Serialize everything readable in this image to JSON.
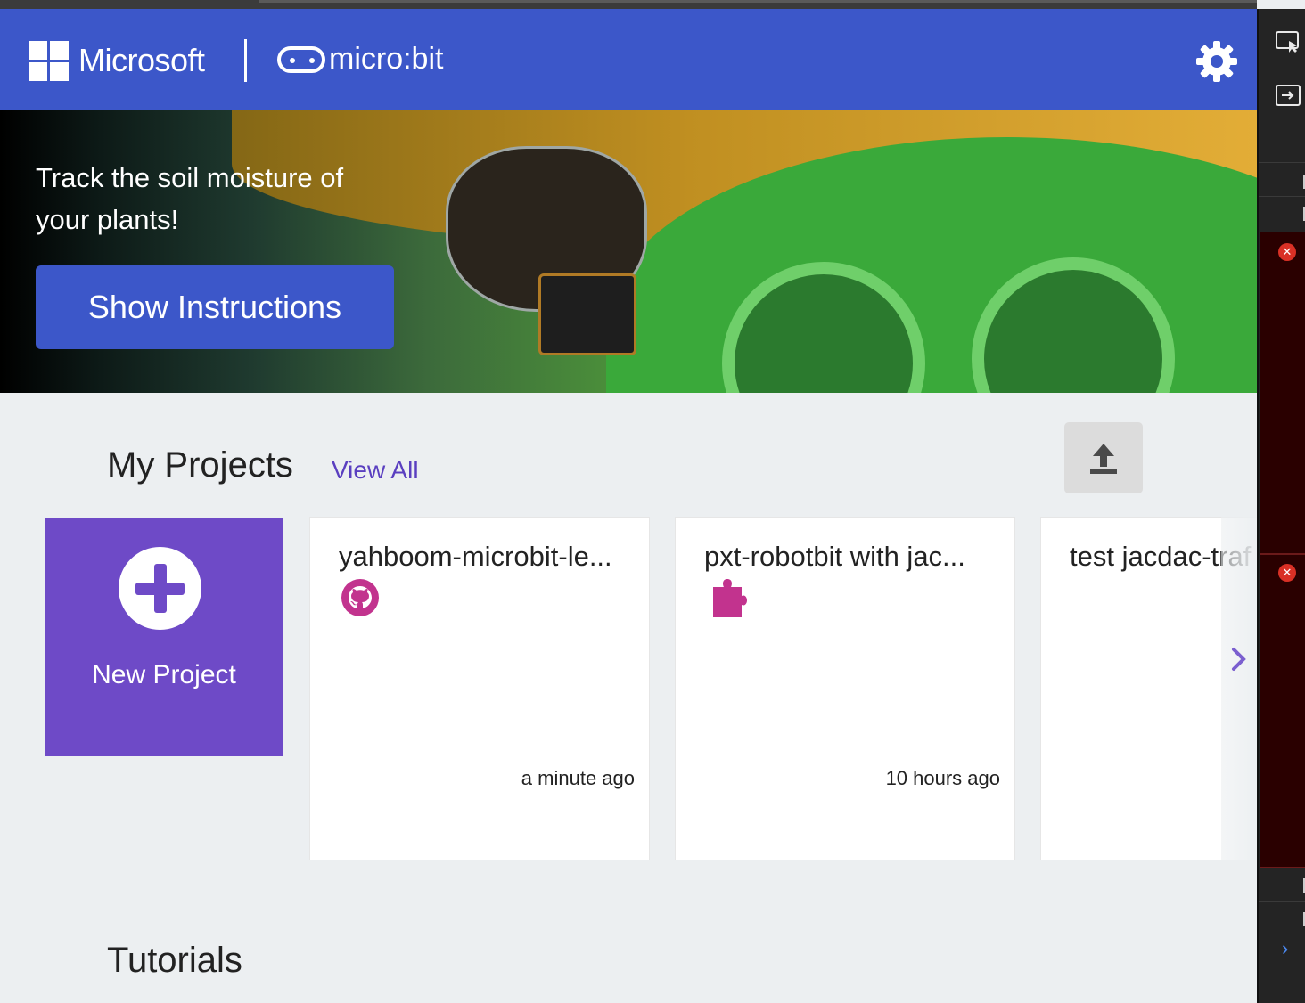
{
  "header": {
    "brand_ms": "Microsoft",
    "brand_mb": "micro:bit",
    "settings_icon": "gear-icon"
  },
  "hero": {
    "title": "Track the soil moisture of your plants!",
    "button_label": "Show Instructions"
  },
  "projects": {
    "heading": "My Projects",
    "view_all": "View All",
    "import_icon": "upload-icon",
    "new_project_label": "New Project",
    "cards": [
      {
        "title": "yahboom-microbit-le...",
        "time": "a minute ago",
        "icon": "github-icon"
      },
      {
        "title": "pxt-robotbit with jac...",
        "time": "10 hours ago",
        "icon": "puzzle-extension-icon"
      },
      {
        "title": "test jacdac-traf",
        "time": "",
        "icon": ""
      }
    ]
  },
  "tutorials": {
    "heading": "Tutorials"
  },
  "colors": {
    "header": "#3c57c9",
    "new_project": "#6e4ac7",
    "link": "#5a3fc0",
    "github": "#c2338e"
  }
}
